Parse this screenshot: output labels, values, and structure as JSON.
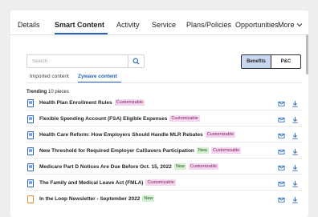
{
  "tabs": [
    {
      "label": "Details",
      "active": false
    },
    {
      "label": "Smart Content",
      "active": true
    },
    {
      "label": "Activity",
      "active": false
    },
    {
      "label": "Service",
      "active": false
    },
    {
      "label": "Plans/Policies",
      "active": false
    },
    {
      "label": "Opportunities",
      "active": false
    },
    {
      "label": "More",
      "active": false
    }
  ],
  "search": {
    "placeholder": "Search",
    "value": ""
  },
  "toggle": {
    "options": [
      "Benefits",
      "P&C"
    ],
    "selected": "Benefits"
  },
  "subtabs": [
    {
      "label": "Imported content",
      "active": false
    },
    {
      "label": "Zywave content",
      "active": true
    }
  ],
  "trending": {
    "label": "Trending",
    "count_text": "10 pieces"
  },
  "badges": {
    "customizable": "Customizable",
    "new": "New"
  },
  "items": [
    {
      "title": "Health Plan Enrollment Rules",
      "customizable": true,
      "new": false,
      "icon_letter": "W"
    },
    {
      "title": "Flexible Spending Account (FSA) Eligible Expenses",
      "customizable": true,
      "new": false,
      "icon_letter": "W"
    },
    {
      "title": "Health Care Reform: How Employers Should Handle MLR Rebates",
      "customizable": true,
      "new": false,
      "icon_letter": "W"
    },
    {
      "title": "New Threshold for Required Employer CalSavers Participation",
      "customizable": true,
      "new": true,
      "icon_letter": "W"
    },
    {
      "title": "Medicare Part D Notices Are Due Before Oct. 15, 2022",
      "customizable": true,
      "new": true,
      "icon_letter": "W"
    },
    {
      "title": "The Family and Medical Leave Act (FMLA)",
      "customizable": true,
      "new": false,
      "icon_letter": "W"
    },
    {
      "title": "In the Loop Newsletter - September 2022",
      "customizable": false,
      "new": true,
      "icon_letter": ""
    }
  ],
  "colors": {
    "accent": "#2a63b6",
    "customizable_bg": "#f4d7ec",
    "new_bg": "#d4efd2",
    "background": "#eeeeee"
  },
  "icons": {
    "search": "search-icon",
    "email": "email-icon",
    "download": "download-icon",
    "more": "chevron-down-icon",
    "document": "word-document-icon",
    "newsletter": "newsletter-document-icon"
  }
}
